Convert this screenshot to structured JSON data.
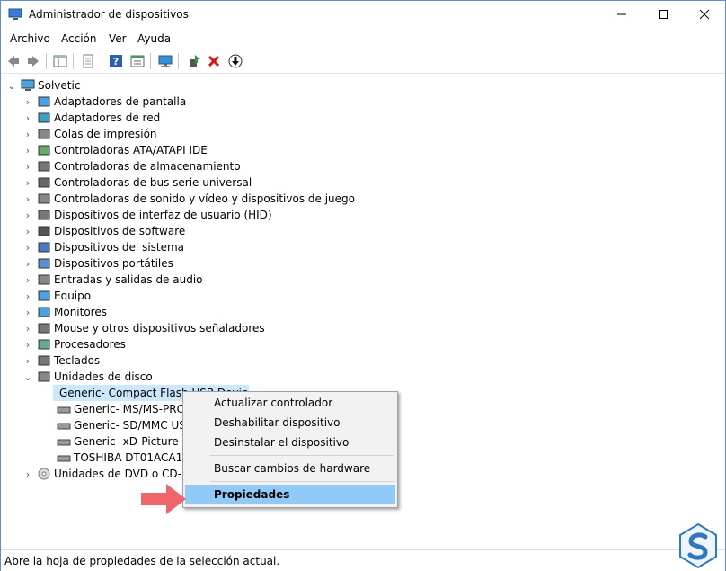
{
  "window": {
    "title": "Administrador de dispositivos"
  },
  "menubar": {
    "items": [
      "Archivo",
      "Acción",
      "Ver",
      "Ayuda"
    ]
  },
  "tree": {
    "root": "Solvetic",
    "categories": [
      "Adaptadores de pantalla",
      "Adaptadores de red",
      "Colas de impresión",
      "Controladoras ATA/ATAPI IDE",
      "Controladoras de almacenamiento",
      "Controladoras de bus serie universal",
      "Controladoras de sonido y vídeo y dispositivos de juego",
      "Dispositivos de interfaz de usuario (HID)",
      "Dispositivos de software",
      "Dispositivos del sistema",
      "Dispositivos portátiles",
      "Entradas y salidas de audio",
      "Equipo",
      "Monitores",
      "Mouse y otros dispositivos señaladores",
      "Procesadores",
      "Teclados",
      "Unidades de disco"
    ],
    "disk_children": [
      "Generic- Compact Flash USB Device",
      "Generic- MS/MS-PRO",
      "Generic- SD/MMC USB",
      "Generic- xD-Picture USB",
      "TOSHIBA DT01ACA100"
    ],
    "last_category": "Unidades de DVD o CD-ROM"
  },
  "context_menu": {
    "items": [
      "Actualizar controlador",
      "Deshabilitar dispositivo",
      "Desinstalar el dispositivo",
      "Buscar cambios de hardware",
      "Propiedades"
    ]
  },
  "statusbar": {
    "text": "Abre la hoja de propiedades de la selección actual."
  },
  "colors": {
    "selection": "#cce8ff",
    "menu_highlight": "#91c9f7",
    "arrow": "#f0656a",
    "logo": "#2f78c0"
  }
}
